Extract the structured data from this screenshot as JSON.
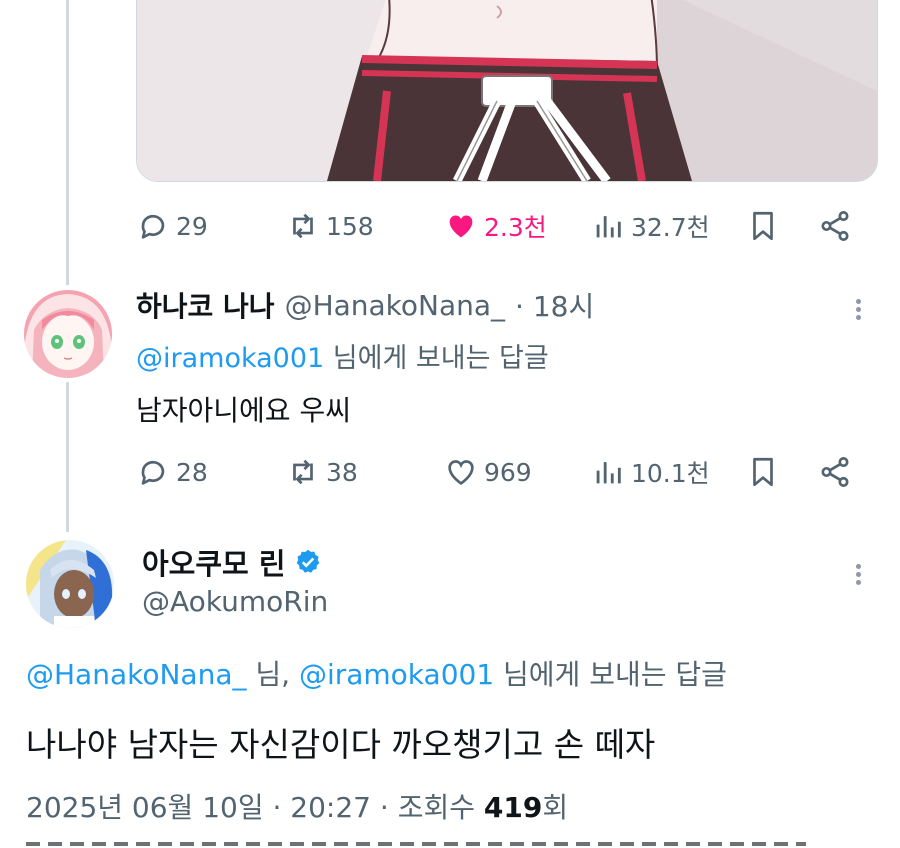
{
  "tweet1": {
    "stats": {
      "replies": "29",
      "retweets": "158",
      "likes": "2.3천",
      "views": "32.7천"
    }
  },
  "reply1": {
    "display_name": "하나코 나나",
    "handle": "@HanakoNana_",
    "time": "· 18시",
    "mention": "@iramoka001",
    "replying_suffix": " 님에게 보내는 답글",
    "text": "남자아니에요 우씨",
    "stats": {
      "replies": "28",
      "retweets": "38",
      "likes": "969",
      "views": "10.1천"
    }
  },
  "main_tweet": {
    "display_name": "아오쿠모 린",
    "handle": "@AokumoRin",
    "verified": true,
    "mention1": "@HanakoNana_",
    "mention_sep": " 님, ",
    "mention2": "@iramoka001",
    "replying_suffix": " 님에게 보내는 답글",
    "text": "나나야 남자는 자신감이다 까오챙기고 손 떼자",
    "date": "2025년 06월 10일 · 20:27 · 조회수 ",
    "views_count": "419",
    "views_unit": "회"
  },
  "colors": {
    "like_active": "#f91880",
    "link": "#1d9bf0",
    "secondary_text": "#536471",
    "verified": "#1d9bf0"
  }
}
